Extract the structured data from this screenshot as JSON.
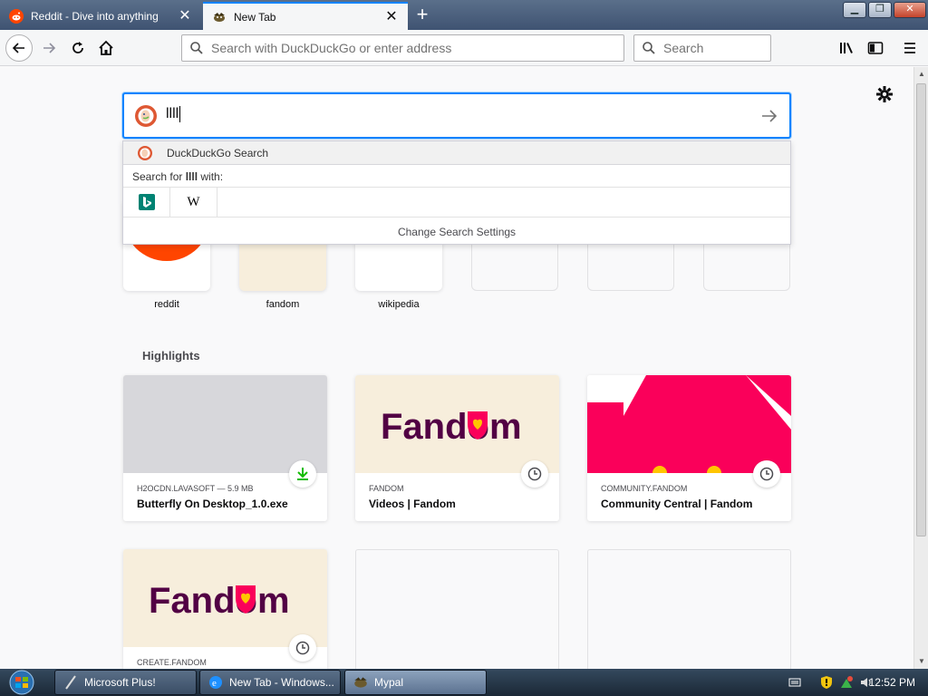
{
  "tabs": [
    {
      "title": "Reddit - Dive into anything",
      "active": false
    },
    {
      "title": "New Tab",
      "active": true
    }
  ],
  "navbar": {
    "url_placeholder": "Search with DuckDuckGo or enter address",
    "search_placeholder": "Search"
  },
  "newtab_search": {
    "value": "llll",
    "engine": "DuckDuckGo"
  },
  "suggest": {
    "engine_row": "DuckDuckGo Search",
    "header_prefix": "Search for ",
    "header_term": "llll",
    "header_suffix": " with:",
    "engines": [
      "bing-icon",
      "wikipedia-icon"
    ],
    "change_settings": "Change Search Settings"
  },
  "top_sites": [
    {
      "label": "reddit"
    },
    {
      "label": "fandom"
    },
    {
      "label": "wikipedia"
    },
    {
      "label": ""
    },
    {
      "label": ""
    },
    {
      "label": ""
    }
  ],
  "highlights": {
    "title": "Highlights",
    "cards": [
      {
        "host": "H2OCDN.LAVASOFT — 5.9 MB",
        "title": "Butterfly On Desktop_1.0.exe",
        "badge": "download-icon"
      },
      {
        "host": "FANDOM",
        "title": "Videos | Fandom",
        "badge": "clock-icon"
      },
      {
        "host": "COMMUNITY.FANDOM",
        "title": "Community Central | Fandom",
        "badge": "clock-icon"
      },
      {
        "host": "CREATE.FANDOM",
        "title": "",
        "badge": "clock-icon"
      }
    ],
    "fandom_logo_text": "Fandom"
  },
  "taskbar": {
    "tasks": [
      "Microsoft Plus!",
      "New Tab - Windows...",
      "Mypal"
    ],
    "clock": "12:52 PM"
  },
  "colors": {
    "accent": "#0a84ff",
    "reddit": "#ff4500",
    "fandom_pink": "#fa005a",
    "fandom_purple": "#520044"
  }
}
